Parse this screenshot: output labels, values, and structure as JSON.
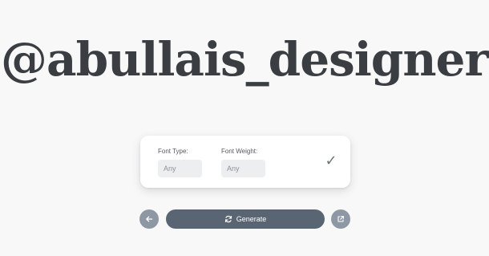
{
  "hero": {
    "title": "@abullais_designer"
  },
  "card": {
    "font_type": {
      "label": "Font Type:",
      "value": "Any"
    },
    "font_weight": {
      "label": "Font Weight:",
      "value": "Any"
    },
    "confirm_icon": "check-icon"
  },
  "actions": {
    "back_icon": "arrow-left-icon",
    "generate_label": "Generate",
    "generate_icon": "refresh-icon",
    "share_icon": "external-link-icon"
  },
  "colors": {
    "background": "#f8f8f9",
    "title": "#3a3e43",
    "primary_button": "#5a6573",
    "secondary_button": "#8e98a4"
  }
}
